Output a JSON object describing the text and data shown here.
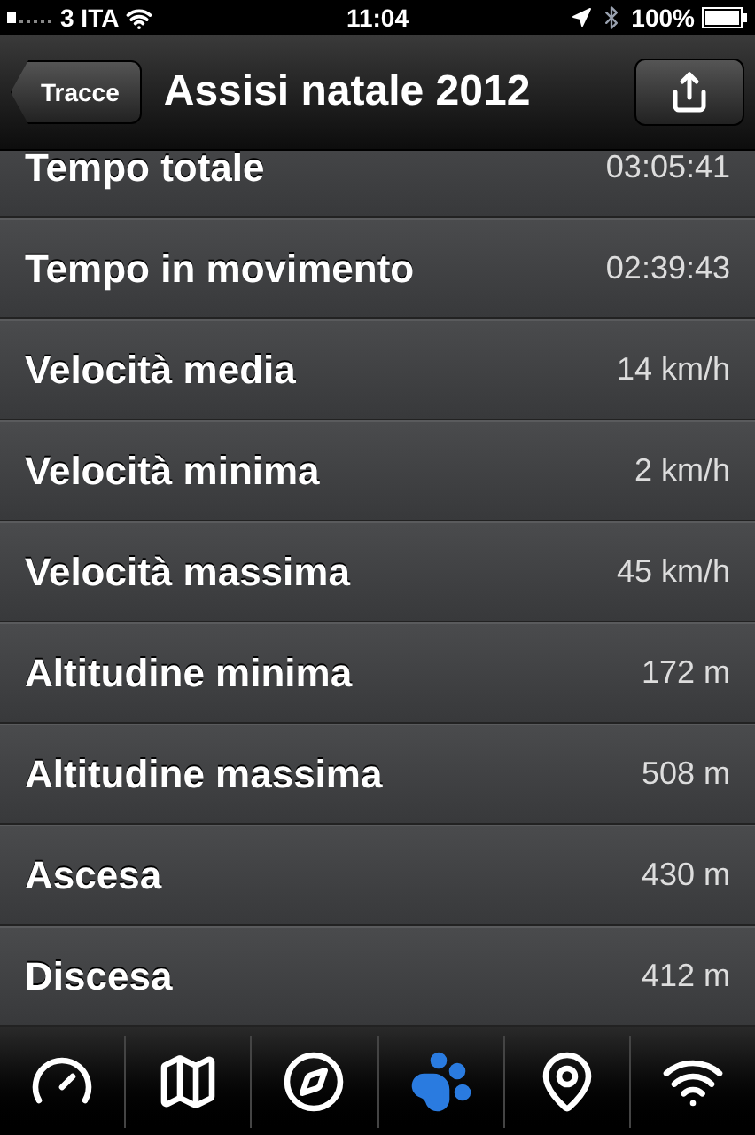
{
  "status_bar": {
    "carrier": "3 ITA",
    "time": "11:04",
    "battery": "100%"
  },
  "nav_bar": {
    "back": "Tracce",
    "title": "Assisi natale 2012"
  },
  "stats": [
    {
      "label": "Tempo totale",
      "value": "03:05:41"
    },
    {
      "label": "Tempo in movimento",
      "value": "02:39:43"
    },
    {
      "label": "Velocità media",
      "value": "14 km/h"
    },
    {
      "label": "Velocità minima",
      "value": "2 km/h"
    },
    {
      "label": "Velocità massima",
      "value": "45 km/h"
    },
    {
      "label": "Altitudine minima",
      "value": "172 m"
    },
    {
      "label": "Altitudine massima",
      "value": "508 m"
    },
    {
      "label": "Ascesa",
      "value": "430 m"
    },
    {
      "label": "Discesa",
      "value": "412 m"
    }
  ],
  "tab_bar": [
    {
      "kind": "gauge",
      "selected": false
    },
    {
      "kind": "map",
      "selected": false
    },
    {
      "kind": "compass",
      "selected": false
    },
    {
      "kind": "paw",
      "selected": true
    },
    {
      "kind": "pin",
      "selected": false
    },
    {
      "kind": "wifi",
      "selected": false
    }
  ]
}
